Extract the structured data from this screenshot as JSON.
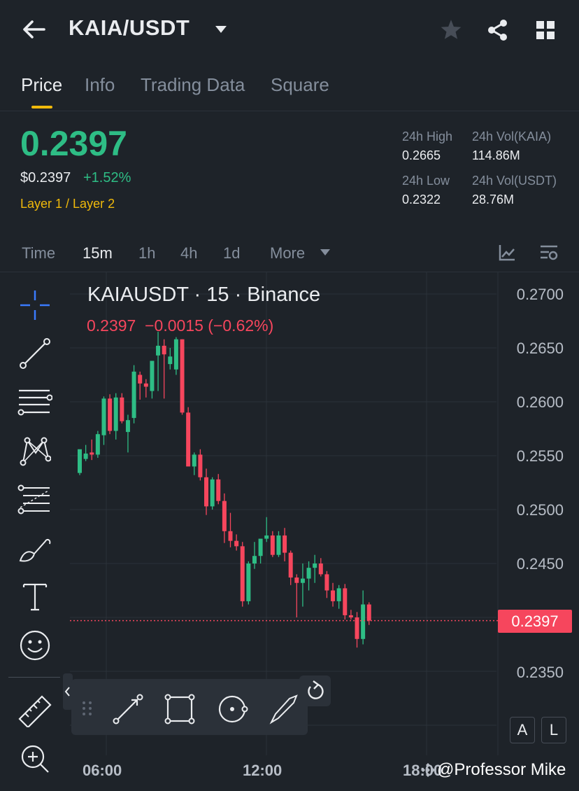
{
  "header": {
    "pair": "KAIA/USDT",
    "icons": [
      "back-arrow-icon",
      "caret-down-icon",
      "star-icon",
      "share-icon",
      "grid-icon"
    ]
  },
  "tabs": [
    {
      "label": "Price",
      "active": true
    },
    {
      "label": "Info",
      "active": false
    },
    {
      "label": "Trading Data",
      "active": false
    },
    {
      "label": "Square",
      "active": false
    }
  ],
  "ticker": {
    "last_price": "0.2397",
    "usd_price": "$0.2397",
    "change_pct": "+1.52%",
    "category": "Layer 1 / Layer 2",
    "high_label": "24h High",
    "high_value": "0.2665",
    "vol_base_label": "24h Vol(KAIA)",
    "vol_base_value": "114.86M",
    "low_label": "24h Low",
    "low_value": "0.2322",
    "vol_quote_label": "24h Vol(USDT)",
    "vol_quote_value": "28.76M"
  },
  "timeframes": {
    "items": [
      "Time",
      "15m",
      "1h",
      "4h",
      "1d",
      "More"
    ],
    "active": "15m"
  },
  "chart": {
    "legend_title": "KAIAUSDT · 15 · Binance",
    "legend_values": "0.2397  −0.0015 (−0.62%)",
    "current_price_label": "0.2397",
    "indicator_left": "A",
    "indicator_right": "L"
  },
  "watermark": "@Professor Mike",
  "colors": {
    "up": "#2ebd85",
    "down": "#f6465d",
    "accent": "#f0b90b",
    "background": "#1e2329"
  },
  "chart_data": {
    "type": "candlestick",
    "y_ticks": [
      "0.2700",
      "0.2650",
      "0.2600",
      "0.2550",
      "0.2500",
      "0.2450",
      "0.2350"
    ],
    "x_ticks": [
      "06:00",
      "12:00",
      "18:00"
    ],
    "ylim": [
      0.2318,
      0.272
    ],
    "x_start_index": 0,
    "candles": [
      {
        "o": 0.2534,
        "h": 0.2555,
        "l": 0.2532,
        "c": 0.2556
      },
      {
        "o": 0.2547,
        "h": 0.256,
        "l": 0.2545,
        "c": 0.2552
      },
      {
        "o": 0.2553,
        "h": 0.2565,
        "l": 0.2546,
        "c": 0.2551
      },
      {
        "o": 0.2551,
        "h": 0.2573,
        "l": 0.2548,
        "c": 0.257
      },
      {
        "o": 0.2569,
        "h": 0.2605,
        "l": 0.256,
        "c": 0.2603
      },
      {
        "o": 0.2603,
        "h": 0.2607,
        "l": 0.257,
        "c": 0.2573
      },
      {
        "o": 0.2573,
        "h": 0.2608,
        "l": 0.2565,
        "c": 0.2604
      },
      {
        "o": 0.2604,
        "h": 0.2608,
        "l": 0.258,
        "c": 0.2582
      },
      {
        "o": 0.2572,
        "h": 0.2588,
        "l": 0.2553,
        "c": 0.2583
      },
      {
        "o": 0.2585,
        "h": 0.2634,
        "l": 0.258,
        "c": 0.2628
      },
      {
        "o": 0.2625,
        "h": 0.2628,
        "l": 0.2602,
        "c": 0.2617
      },
      {
        "o": 0.2617,
        "h": 0.2621,
        "l": 0.2604,
        "c": 0.2614
      },
      {
        "o": 0.261,
        "h": 0.2636,
        "l": 0.2603,
        "c": 0.2638
      },
      {
        "o": 0.2643,
        "h": 0.2665,
        "l": 0.261,
        "c": 0.2652
      },
      {
        "o": 0.2652,
        "h": 0.2658,
        "l": 0.2603,
        "c": 0.2644
      },
      {
        "o": 0.2635,
        "h": 0.265,
        "l": 0.263,
        "c": 0.2642
      },
      {
        "o": 0.263,
        "h": 0.266,
        "l": 0.2625,
        "c": 0.2658
      },
      {
        "o": 0.2658,
        "h": 0.2658,
        "l": 0.2588,
        "c": 0.259
      },
      {
        "o": 0.259,
        "h": 0.2595,
        "l": 0.2545,
        "c": 0.254
      },
      {
        "o": 0.254,
        "h": 0.2553,
        "l": 0.2532,
        "c": 0.2551
      },
      {
        "o": 0.2551,
        "h": 0.2556,
        "l": 0.2527,
        "c": 0.253
      },
      {
        "o": 0.253,
        "h": 0.2538,
        "l": 0.2495,
        "c": 0.2503
      },
      {
        "o": 0.2503,
        "h": 0.253,
        "l": 0.25,
        "c": 0.2528
      },
      {
        "o": 0.2528,
        "h": 0.2533,
        "l": 0.2505,
        "c": 0.2508
      },
      {
        "o": 0.2508,
        "h": 0.2515,
        "l": 0.2469,
        "c": 0.248
      },
      {
        "o": 0.248,
        "h": 0.2497,
        "l": 0.2465,
        "c": 0.2471
      },
      {
        "o": 0.2471,
        "h": 0.2477,
        "l": 0.2462,
        "c": 0.2466
      },
      {
        "o": 0.2466,
        "h": 0.247,
        "l": 0.241,
        "c": 0.2415
      },
      {
        "o": 0.2415,
        "h": 0.2452,
        "l": 0.2412,
        "c": 0.245
      },
      {
        "o": 0.245,
        "h": 0.247,
        "l": 0.2445,
        "c": 0.2457
      },
      {
        "o": 0.2457,
        "h": 0.247,
        "l": 0.245,
        "c": 0.2473
      },
      {
        "o": 0.2473,
        "h": 0.2493,
        "l": 0.247,
        "c": 0.2476
      },
      {
        "o": 0.2476,
        "h": 0.248,
        "l": 0.2456,
        "c": 0.2458
      },
      {
        "o": 0.2458,
        "h": 0.248,
        "l": 0.2456,
        "c": 0.2476
      },
      {
        "o": 0.2476,
        "h": 0.2483,
        "l": 0.2452,
        "c": 0.246
      },
      {
        "o": 0.246,
        "h": 0.2462,
        "l": 0.243,
        "c": 0.2437
      },
      {
        "o": 0.2437,
        "h": 0.244,
        "l": 0.24,
        "c": 0.2432
      },
      {
        "o": 0.2432,
        "h": 0.245,
        "l": 0.241,
        "c": 0.2436
      },
      {
        "o": 0.2436,
        "h": 0.2452,
        "l": 0.2425,
        "c": 0.2446
      },
      {
        "o": 0.2446,
        "h": 0.2458,
        "l": 0.2432,
        "c": 0.245
      },
      {
        "o": 0.245,
        "h": 0.2455,
        "l": 0.2438,
        "c": 0.244
      },
      {
        "o": 0.244,
        "h": 0.2443,
        "l": 0.2418,
        "c": 0.2425
      },
      {
        "o": 0.2425,
        "h": 0.2432,
        "l": 0.241,
        "c": 0.2415
      },
      {
        "o": 0.2415,
        "h": 0.243,
        "l": 0.2408,
        "c": 0.2427
      },
      {
        "o": 0.2427,
        "h": 0.2431,
        "l": 0.2398,
        "c": 0.2402
      },
      {
        "o": 0.2402,
        "h": 0.2407,
        "l": 0.2398,
        "c": 0.24
      },
      {
        "o": 0.24,
        "h": 0.2405,
        "l": 0.2372,
        "c": 0.238
      },
      {
        "o": 0.238,
        "h": 0.2425,
        "l": 0.2375,
        "c": 0.2412
      },
      {
        "o": 0.2412,
        "h": 0.2414,
        "l": 0.2393,
        "c": 0.2397
      }
    ]
  }
}
